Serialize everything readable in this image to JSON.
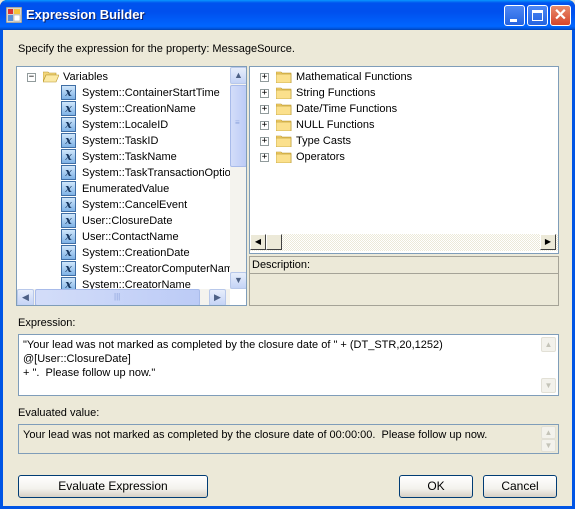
{
  "window": {
    "title": "Expression Builder",
    "controls": {
      "minimize": "minimize-icon",
      "maximize": "maximize-icon",
      "close": "close-icon"
    }
  },
  "prompt": "Specify the expression for the property: MessageSource.",
  "variables_tree": {
    "root": {
      "label": "Variables",
      "expanded": true,
      "icon": "open-folder-icon"
    },
    "items": [
      {
        "label": "System::ContainerStartTime"
      },
      {
        "label": "System::CreationName"
      },
      {
        "label": "System::LocaleID"
      },
      {
        "label": "System::TaskID"
      },
      {
        "label": "System::TaskName"
      },
      {
        "label": "System::TaskTransactionOption"
      },
      {
        "label": "EnumeratedValue"
      },
      {
        "label": "System::CancelEvent"
      },
      {
        "label": "User::ClosureDate"
      },
      {
        "label": "User::ContactName"
      },
      {
        "label": "System::CreationDate"
      },
      {
        "label": "System::CreatorComputerName"
      },
      {
        "label": "System::CreatorName"
      }
    ]
  },
  "functions_tree": {
    "items": [
      {
        "label": "Mathematical Functions",
        "expanded": false
      },
      {
        "label": "String Functions",
        "expanded": false
      },
      {
        "label": "Date/Time Functions",
        "expanded": false
      },
      {
        "label": "NULL Functions",
        "expanded": false
      },
      {
        "label": "Type Casts",
        "expanded": false
      },
      {
        "label": "Operators",
        "expanded": false
      }
    ]
  },
  "description": {
    "label": "Description:",
    "value": ""
  },
  "expression": {
    "label": "Expression:",
    "value": "\"Your lead was not marked as completed by the closure date of \" + (DT_STR,20,1252) @[User::ClosureDate]\n+ \".  Please follow up now.\""
  },
  "evaluated": {
    "label": "Evaluated value:",
    "value": "Your lead was not marked as completed by the closure date of 00:00:00.  Please follow up now."
  },
  "buttons": {
    "evaluate": "Evaluate Expression",
    "ok": "OK",
    "cancel": "Cancel"
  },
  "glyphs": {
    "expand": "+",
    "collapse": "−",
    "up": "▲",
    "down": "▼",
    "left": "◀",
    "right": "▶",
    "variable": "x",
    "close": "✕"
  }
}
